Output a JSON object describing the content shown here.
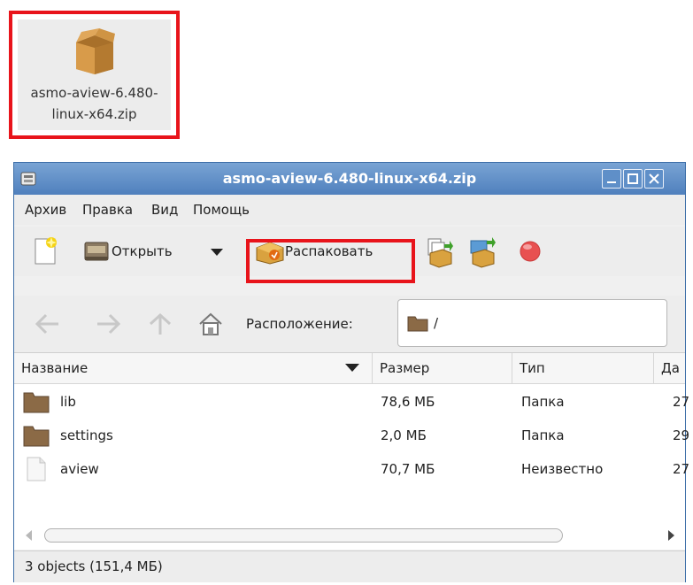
{
  "desktop_icon": {
    "label_line1": "asmo-aview-6.480-",
    "label_line2": "linux-x64.zip"
  },
  "window": {
    "title": "asmo-aview-6.480-linux-x64.zip",
    "title_bar_color": "#5a89c4"
  },
  "menu": [
    "Архив",
    "Правка",
    "Вид",
    "Помощь"
  ],
  "toolbar": {
    "open_label": "Открыть",
    "extract_label": "Распаковать"
  },
  "location": {
    "label": "Расположение:",
    "path": "/"
  },
  "columns": [
    "Название",
    "Размер",
    "Тип",
    "Да"
  ],
  "rows": [
    {
      "name": "lib",
      "size": "78,6 МБ",
      "type": "Папка",
      "date": "27",
      "icon": "folder-icon"
    },
    {
      "name": "settings",
      "size": "2,0 МБ",
      "type": "Папка",
      "date": "29",
      "icon": "folder-icon"
    },
    {
      "name": "aview",
      "size": "70,7 МБ",
      "type": "Неизвестно",
      "date": "27",
      "icon": "file-icon"
    }
  ],
  "status": "3 objects (151,4 МБ)",
  "colors": {
    "highlight": "#e8141b",
    "folder": "#8b6a46"
  }
}
